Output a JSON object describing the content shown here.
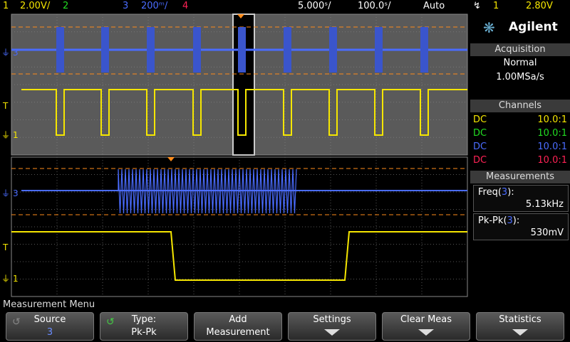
{
  "topbar": {
    "ch1": "1",
    "ch1_scale": "2.00V/",
    "ch2": "2",
    "ch3": "3",
    "ch3_scale": "200ᵐ/",
    "ch4": "4",
    "zoom_timebase": "5.000ˢ/",
    "main_timebase": "100.0ˢ/",
    "trigger_mode": "Auto",
    "trigger_source": "1",
    "trigger_level": "2.80V"
  },
  "colors": {
    "ch1": "#f5e600",
    "ch2": "#22dd22",
    "ch3": "#4a6cff",
    "ch4": "#ff2255",
    "trigger": "#ff8c1a"
  },
  "scope": {
    "ch3_label": "3",
    "ch1_label": "1",
    "trigger_marker": "T"
  },
  "panel": {
    "brand": "Agilent",
    "acquisition_title": "Acquisition",
    "acquisition_mode": "Normal",
    "sample_rate": "1.00MSa/s",
    "channels_title": "Channels",
    "channels": [
      {
        "coupling": "DC",
        "probe": "10.0:1"
      },
      {
        "coupling": "DC",
        "probe": "10.0:1"
      },
      {
        "coupling": "DC",
        "probe": "10.0:1"
      },
      {
        "coupling": "DC",
        "probe": "10.0:1"
      }
    ],
    "measurements_title": "Measurements",
    "measurements": [
      {
        "label": "Freq",
        "src": "3",
        "value": "5.13kHz"
      },
      {
        "label": "Pk-Pk",
        "src": "3",
        "value": "530mV"
      }
    ]
  },
  "menu": {
    "title": "Measurement Menu",
    "softkeys": [
      {
        "l1": "Source",
        "l2": "3"
      },
      {
        "l1": "Type:",
        "l2": "Pk-Pk"
      },
      {
        "l1": "Add",
        "l2": "Measurement"
      },
      {
        "l1": "Settings",
        "l2": ""
      },
      {
        "l1": "Clear Meas",
        "l2": ""
      },
      {
        "l1": "Statistics",
        "l2": ""
      }
    ]
  }
}
